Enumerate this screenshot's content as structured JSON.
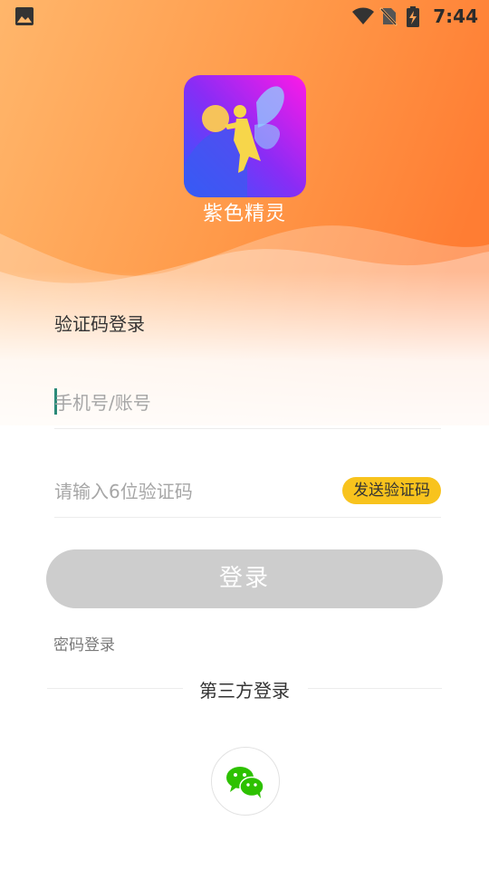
{
  "status_bar": {
    "time": "7:44",
    "icons": [
      "image-icon",
      "wifi-icon",
      "no-sim-icon",
      "battery-charging-icon"
    ]
  },
  "app": {
    "name": "紫色精灵",
    "logo": "fairy-logo-icon"
  },
  "login_form": {
    "title": "验证码登录",
    "phone_placeholder": "手机号/账号",
    "phone_value": "",
    "code_placeholder": "请输入6位验证码",
    "code_value": "",
    "send_code_label": "发送验证码",
    "submit_label": "登录",
    "password_login_label": "密码登录"
  },
  "third_party": {
    "title": "第三方登录",
    "providers": [
      "wechat-icon"
    ]
  },
  "colors": {
    "header_orange": "#ff8a3c",
    "send_button": "#f8c31d",
    "login_disabled": "#cdcdcd",
    "caret": "#2b8a78",
    "wechat_green": "#2dc100"
  }
}
